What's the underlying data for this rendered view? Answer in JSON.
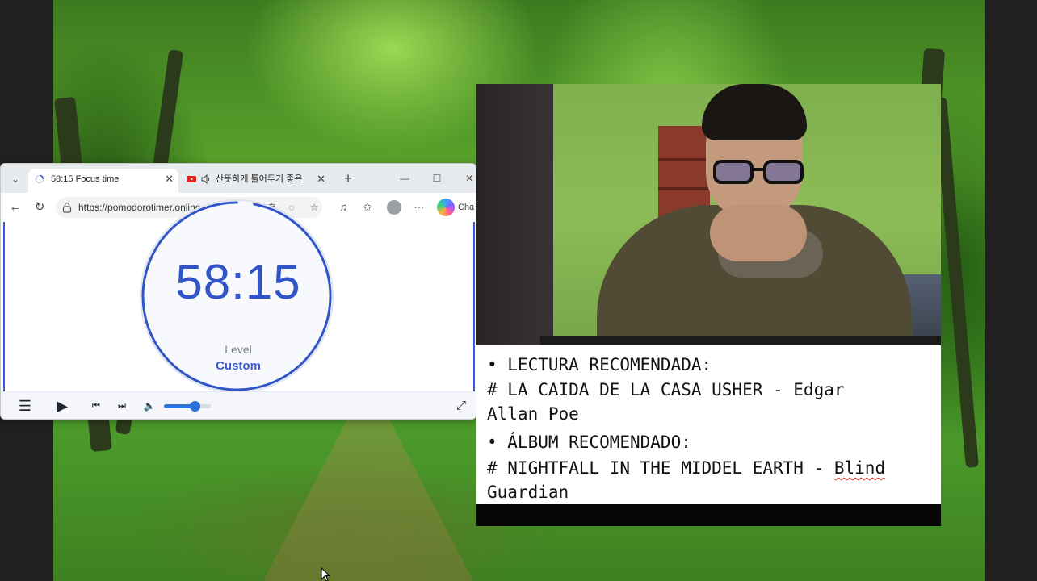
{
  "browser": {
    "tabs": [
      {
        "title": "58:15 Focus time",
        "active": true,
        "favicon": "loading-spinner-icon"
      },
      {
        "title": "산뜻하게 틀어두기 좋은",
        "active": false,
        "favicon": "youtube-icon",
        "audio": "speaker-icon"
      }
    ],
    "new_tab_label": "+",
    "url": "https://pomodorotimer.online",
    "copilot_label": "Cha"
  },
  "timer": {
    "display": "58:15",
    "level_label": "Level",
    "level_value": "Custom",
    "progress": 0.97,
    "accent_color": "#2f55c8"
  },
  "player": {
    "volume": 0.65,
    "accent_color": "#2d72d9"
  },
  "caption": {
    "line1": "• LECTURA RECOMENDADA:",
    "line2": "# LA CAIDA DE LA CASA USHER - Edgar",
    "line3": "Allan Poe",
    "line4": "• ÁLBUM RECOMENDADO:",
    "line5_main": "# NIGHTFALL IN THE MIDDEL EARTH - ",
    "line5_flag": "Blind",
    "line6": "Guardian"
  }
}
